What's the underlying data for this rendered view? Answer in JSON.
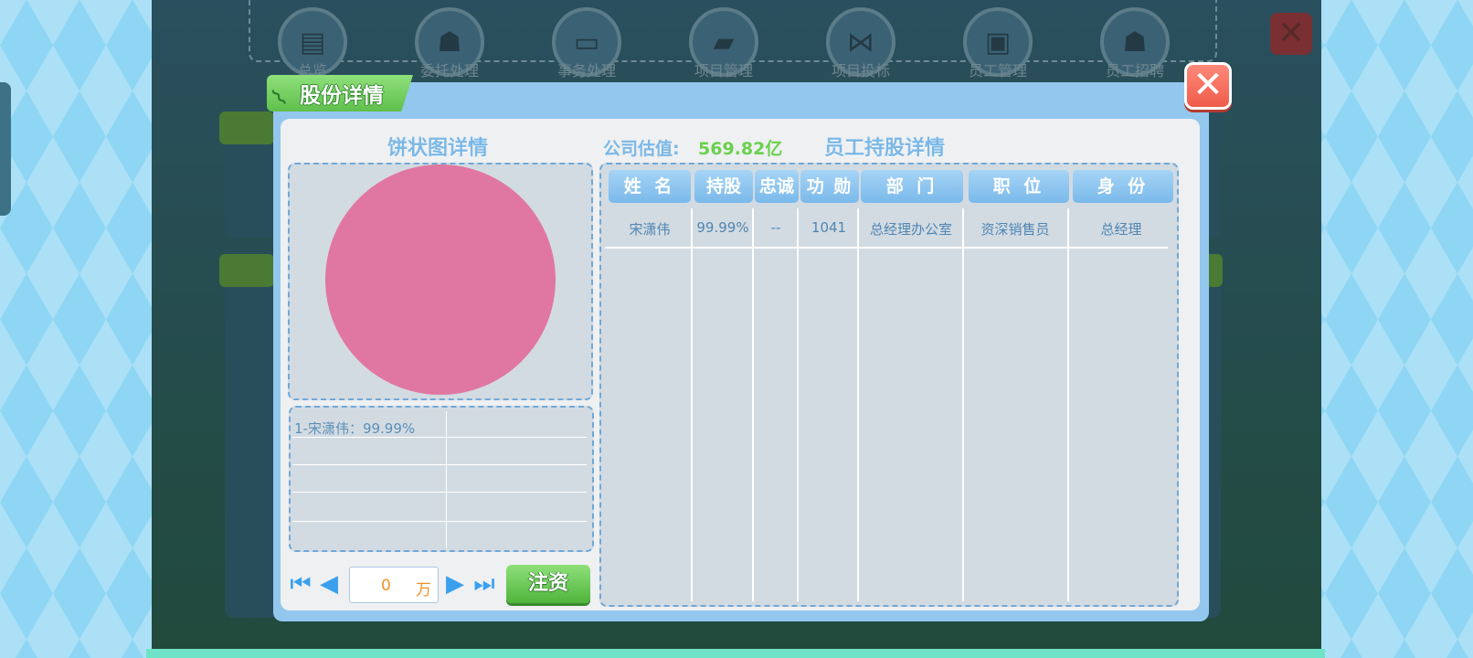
{
  "background": {
    "toolbar": [
      {
        "label": "总览",
        "icon": "clipboard-icon"
      },
      {
        "label": "委托处理",
        "icon": "person-icon"
      },
      {
        "label": "事务处理",
        "icon": "chat-icon"
      },
      {
        "label": "项目管理",
        "icon": "folder-icon"
      },
      {
        "label": "项目投标",
        "icon": "share-icon"
      },
      {
        "label": "员工管理",
        "icon": "employee-card-icon"
      },
      {
        "label": "员工招聘",
        "icon": "person-icon"
      }
    ],
    "close_glyph": "✕"
  },
  "dialog": {
    "title": "股份详情",
    "close_glyph": "✕",
    "pie_section_title": "饼状图详情",
    "valuation_label": "公司估值:",
    "valuation_value": "569.82亿",
    "holdings_section_title": "员工持股详情"
  },
  "chart_data": {
    "type": "pie",
    "slices": [
      {
        "label": "宋潇伟",
        "value": 99.99,
        "color": "#e077a2"
      }
    ],
    "legend": [
      "1-宋潇伟：99.99%"
    ]
  },
  "pagination": {
    "first_glyph": "⏮",
    "prev_glyph": "◀",
    "next_glyph": "▶",
    "last_glyph": "⏭",
    "amount_value": "0",
    "amount_unit": "万",
    "inject_label": "注资"
  },
  "table": {
    "headers": [
      "姓 名",
      "持股",
      "忠诚",
      "功 勋",
      "部 门",
      "职 位",
      "身 份"
    ],
    "rows": [
      {
        "name": "宋潇伟",
        "shares": "99.99%",
        "loyalty": "--",
        "merit": "1041",
        "department": "总经理办公室",
        "position": "资深销售员",
        "identity": "总经理"
      }
    ]
  },
  "colors": {
    "pie_fill": "#e077a2",
    "accent_blue": "#7ab9ea",
    "accent_green": "#6bd04d"
  }
}
